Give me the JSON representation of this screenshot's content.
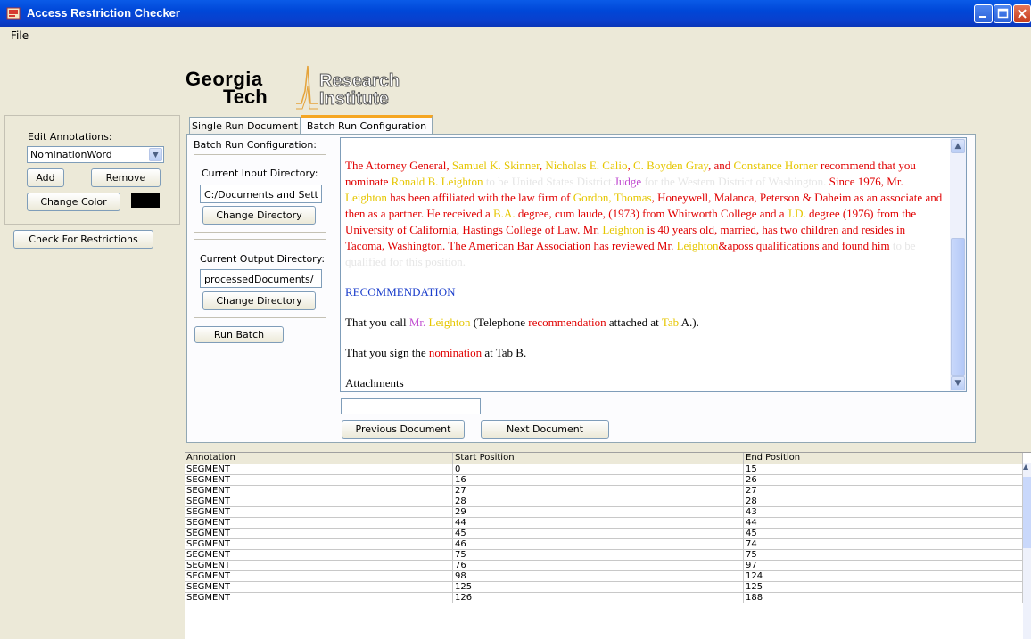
{
  "window": {
    "title": "Access Restriction Checker"
  },
  "menu": {
    "file_label": "File"
  },
  "logo": {
    "line1": "Georgia",
    "line2": "Tech",
    "line3": "Research",
    "line4": "Institute"
  },
  "annotations_panel": {
    "label": "Edit Annotations:",
    "selected_annotation": "NominationWord",
    "add_label": "Add",
    "remove_label": "Remove",
    "change_color_label": "Change Color",
    "swatch_color": "#000000"
  },
  "check_button_label": "Check For Restrictions",
  "tabs": [
    {
      "label": "Single Run Document"
    },
    {
      "label": "Batch Run Configuration"
    }
  ],
  "batch": {
    "title": "Batch Run Configuration:",
    "input_dir_label": "Current Input Directory:",
    "input_dir_value": "C:/Documents and Sett",
    "change_dir_label": "Change Directory",
    "output_dir_label": "Current Output Directory:",
    "output_dir_value": "processedDocuments/",
    "change_dir_label_2": "Change Directory",
    "run_batch_label": "Run Batch"
  },
  "document": {
    "p1": [
      {
        "t": "The Attorney General, ",
        "c": "r"
      },
      {
        "t": "Samuel K. Skinner",
        "c": "y"
      },
      {
        "t": ", ",
        "c": "r"
      },
      {
        "t": "Nicholas E. Calio",
        "c": "y"
      },
      {
        "t": ", ",
        "c": "r"
      },
      {
        "t": "C. Boyden Gray",
        "c": "y"
      },
      {
        "t": ", and ",
        "c": "r"
      },
      {
        "t": "Constance Horner",
        "c": "y"
      },
      {
        "t": " recommend that you nominate ",
        "c": "r"
      },
      {
        "t": "Ronald B. Leighton",
        "c": "y"
      },
      {
        "t": " to be United States District ",
        "c": "g"
      },
      {
        "t": "Judge",
        "c": "m"
      },
      {
        "t": " for the Western District of Washington.",
        "c": "g"
      },
      {
        "t": " Since 1976, Mr. ",
        "c": "r"
      },
      {
        "t": "Leighton",
        "c": "y"
      },
      {
        "t": " has been affiliated with the law firm of ",
        "c": "r"
      },
      {
        "t": "Gordon, Thomas",
        "c": "y"
      },
      {
        "t": ", Honeywell, Malanca, Peterson & Daheim as an associate and then as a partner. He received a ",
        "c": "r"
      },
      {
        "t": "B.A.",
        "c": "y"
      },
      {
        "t": " degree, cum laude, (1973) from Whitworth College and a ",
        "c": "r"
      },
      {
        "t": "J.D.",
        "c": "y"
      },
      {
        "t": " degree (1976) from the University of California, Hastings College of Law. Mr. ",
        "c": "r"
      },
      {
        "t": "Leighton",
        "c": "y"
      },
      {
        "t": " is 40 years old, married, has two children and resides in Tacoma, Washington. The American Bar Association has reviewed Mr. ",
        "c": "r"
      },
      {
        "t": "Leighton",
        "c": "y"
      },
      {
        "t": "&aposs qualifications and found him",
        "c": "r"
      },
      {
        "t": " to be qualified for this position.",
        "c": "g"
      }
    ],
    "heading": "RECOMMENDATION",
    "p2": [
      {
        "t": "That you call ",
        "c": ""
      },
      {
        "t": "Mr. ",
        "c": "m"
      },
      {
        "t": "Leighton",
        "c": "y"
      },
      {
        "t": " (Telephone ",
        "c": ""
      },
      {
        "t": "recommendation",
        "c": "r"
      },
      {
        "t": " attached at ",
        "c": ""
      },
      {
        "t": "Tab",
        "c": "y"
      },
      {
        "t": " A.).",
        "c": ""
      }
    ],
    "p3": [
      {
        "t": "That you sign the ",
        "c": ""
      },
      {
        "t": "nomination",
        "c": "r"
      },
      {
        "t": " at Tab B.",
        "c": ""
      }
    ],
    "p4": "Attachments"
  },
  "nav": {
    "search_value": "",
    "prev_label": "Previous Document",
    "next_label": "Next Document"
  },
  "table": {
    "columns": [
      "Annotation",
      "Start Position",
      "End Position"
    ],
    "rows": [
      [
        "SEGMENT",
        "0",
        "15"
      ],
      [
        "SEGMENT",
        "16",
        "26"
      ],
      [
        "SEGMENT",
        "27",
        "27"
      ],
      [
        "SEGMENT",
        "28",
        "28"
      ],
      [
        "SEGMENT",
        "29",
        "43"
      ],
      [
        "SEGMENT",
        "44",
        "44"
      ],
      [
        "SEGMENT",
        "45",
        "45"
      ],
      [
        "SEGMENT",
        "46",
        "74"
      ],
      [
        "SEGMENT",
        "75",
        "75"
      ],
      [
        "SEGMENT",
        "76",
        "97"
      ],
      [
        "SEGMENT",
        "98",
        "124"
      ],
      [
        "SEGMENT",
        "125",
        "125"
      ],
      [
        "SEGMENT",
        "126",
        "188"
      ]
    ]
  }
}
